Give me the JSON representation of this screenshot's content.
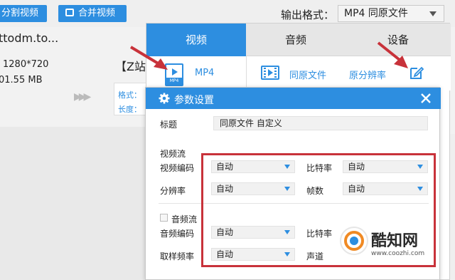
{
  "toolbar": {
    "split_label": "分割视频",
    "merge_label": "合并视频",
    "output_format_label": "输出格式：",
    "output_format_value": "MP4  同原文件"
  },
  "file": {
    "name": "ttodm.to...",
    "resolution": "1280*720",
    "size": "01.55 MB",
    "output_name": "【Z站",
    "meta_format_label": "格式：",
    "meta_length_label": "长度："
  },
  "panel": {
    "tabs": [
      "视频",
      "音频",
      "设备"
    ],
    "mp4_label": "MP4",
    "mp4_icon_label": "MP4",
    "same_file": "同原文件",
    "same_res": "原分辨率"
  },
  "dialog": {
    "title": "参数设置",
    "title_label": "标题",
    "title_value": "同原文件 自定义",
    "video_stream": "视频流",
    "video_codec": "视频编码",
    "bitrate": "比特率",
    "resolution": "分辨率",
    "framerate": "帧数",
    "audio_stream": "音频流",
    "audio_codec": "音频编码",
    "audio_bitrate": "比特率",
    "samplerate": "取样频率",
    "channel": "声道",
    "auto": "自动"
  },
  "watermark": {
    "name": "酷知网",
    "url": "www.coozhi.com"
  },
  "colors": {
    "accent": "#2d8ee0",
    "highlight": "#c8323a"
  }
}
